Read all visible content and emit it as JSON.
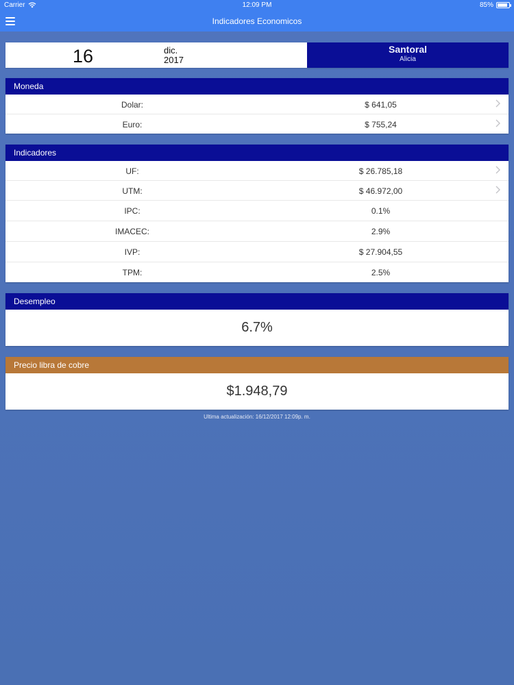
{
  "status_bar": {
    "carrier": "Carrier",
    "time": "12:09 PM",
    "battery_text": "85%",
    "battery_level": 0.85
  },
  "nav": {
    "title": "Indicadores Economicos"
  },
  "date": {
    "day": "16",
    "month": "dic.",
    "year": "2017"
  },
  "santoral": {
    "title": "Santoral",
    "name": "Alicia"
  },
  "moneda": {
    "header": "Moneda",
    "rows": [
      {
        "label": "Dolar:",
        "value": "$ 641,05"
      },
      {
        "label": "Euro:",
        "value": "$ 755,24"
      }
    ]
  },
  "indicadores": {
    "header": "Indicadores",
    "rows": [
      {
        "label": "UF:",
        "value": "$ 26.785,18"
      },
      {
        "label": "UTM:",
        "value": "$ 46.972,00"
      },
      {
        "label": "IPC:",
        "value": "0.1%"
      },
      {
        "label": "IMACEC:",
        "value": "2.9%"
      },
      {
        "label": "IVP:",
        "value": "$ 27.904,55"
      },
      {
        "label": "TPM:",
        "value": "2.5%"
      }
    ]
  },
  "desempleo": {
    "header": "Desempleo",
    "value": "6.7%"
  },
  "cobre": {
    "header": "Precio libra de cobre",
    "value": "$1.948,79"
  },
  "footer": {
    "last_update": "Ultima actualización: 16/12/2017 12:09p. m."
  },
  "colors": {
    "navbar": "#3f80f0",
    "section_header": "#0a0e96",
    "copper_header": "#b87838",
    "background": "#4f72b9"
  }
}
